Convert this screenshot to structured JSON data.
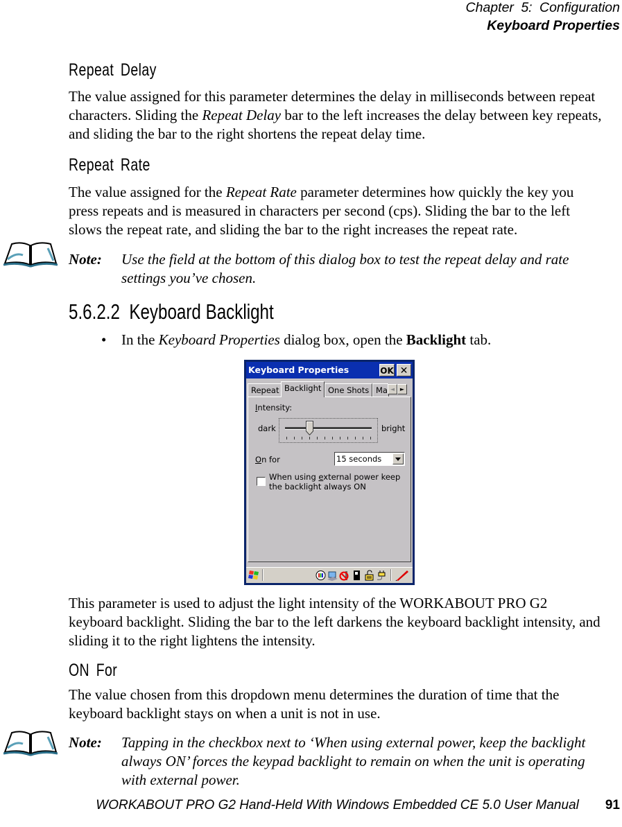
{
  "header": {
    "chapter": "Chapter  5:  Configuration",
    "section": "Keyboard Properties"
  },
  "repeat_delay": {
    "heading": "Repeat  Delay",
    "body_1": "The value assigned for this parameter determines the delay in milliseconds between repeat characters. Sliding the ",
    "body_em": "Repeat Delay",
    "body_2": " bar to the left increases the delay between key repeats, and sliding the bar to the right shortens the repeat delay time."
  },
  "repeat_rate": {
    "heading": "Repeat  Rate",
    "body_1": "The value assigned for the ",
    "body_em": "Repeat Rate",
    "body_2": " parameter determines how quickly the key you press repeats and is measured in characters per second (cps). Sliding the bar to the left slows the repeat rate, and sliding the bar to the right increases the repeat rate."
  },
  "note_1": {
    "label": "Note:",
    "text": "Use the field at the bottom of this dialog box to test the repeat delay and rate settings you’ve chosen."
  },
  "section": {
    "number": "5.6.2.2",
    "title": "Keyboard  Backlight"
  },
  "bullet": {
    "marker": "•",
    "text_1": "In the ",
    "text_em": "Keyboard Properties",
    "text_2": " dialog box, open the ",
    "text_bold": "Backlight",
    "text_3": " tab."
  },
  "dialog": {
    "title": "Keyboard Properties",
    "ok_label": "OK",
    "close_label": "✕",
    "tabs": [
      {
        "label": "Repeat",
        "active": false
      },
      {
        "label": "Backlight",
        "active": true
      },
      {
        "label": "One Shots",
        "active": false
      },
      {
        "label": "Ma",
        "active": false
      }
    ],
    "tab_scroll_left": "◄",
    "tab_scroll_right": "►",
    "intensity_label_pre": "",
    "intensity_label_u": "I",
    "intensity_label_post": "ntensity:",
    "slider_min_label": "dark",
    "slider_max_label": "bright",
    "slider_ticks": 12,
    "slider_value_fraction": 0.27,
    "onfor_label_u": "O",
    "onfor_label_post": "n for",
    "onfor_value": "15 seconds",
    "checkbox_checked": false,
    "checkbox_line1_pre": "When using ",
    "checkbox_line1_u": "e",
    "checkbox_line1_post": "xternal power keep",
    "checkbox_line2": "the backlight always ON",
    "taskbar_icons": [
      "start-icon",
      "network-icon",
      "connection-icon",
      "no-signal-icon",
      "battery-icon",
      "keyboard-lock-icon",
      "power-plug-icon",
      "stylus-icon"
    ]
  },
  "backlight_para": "This parameter is used to adjust the light intensity of the WORKABOUT PRO G2 keyboard backlight. Sliding the bar to the left darkens the keyboard backlight intensity, and sliding it to the right lightens the intensity.",
  "on_for": {
    "heading": "ON  For",
    "body": "The value chosen from this dropdown menu determines the duration of time that the keyboard backlight stays on when a unit is not in use."
  },
  "note_2": {
    "label": "Note:",
    "text": "Tapping in the checkbox next to ‘When using external power, keep the backlight always ON’ forces the keypad backlight to remain on when the unit is operating with external power."
  },
  "footer": {
    "manual_title": "WORKABOUT PRO G2 Hand-Held With Windows Embedded CE 5.0 User Manual",
    "page_number": "91"
  }
}
